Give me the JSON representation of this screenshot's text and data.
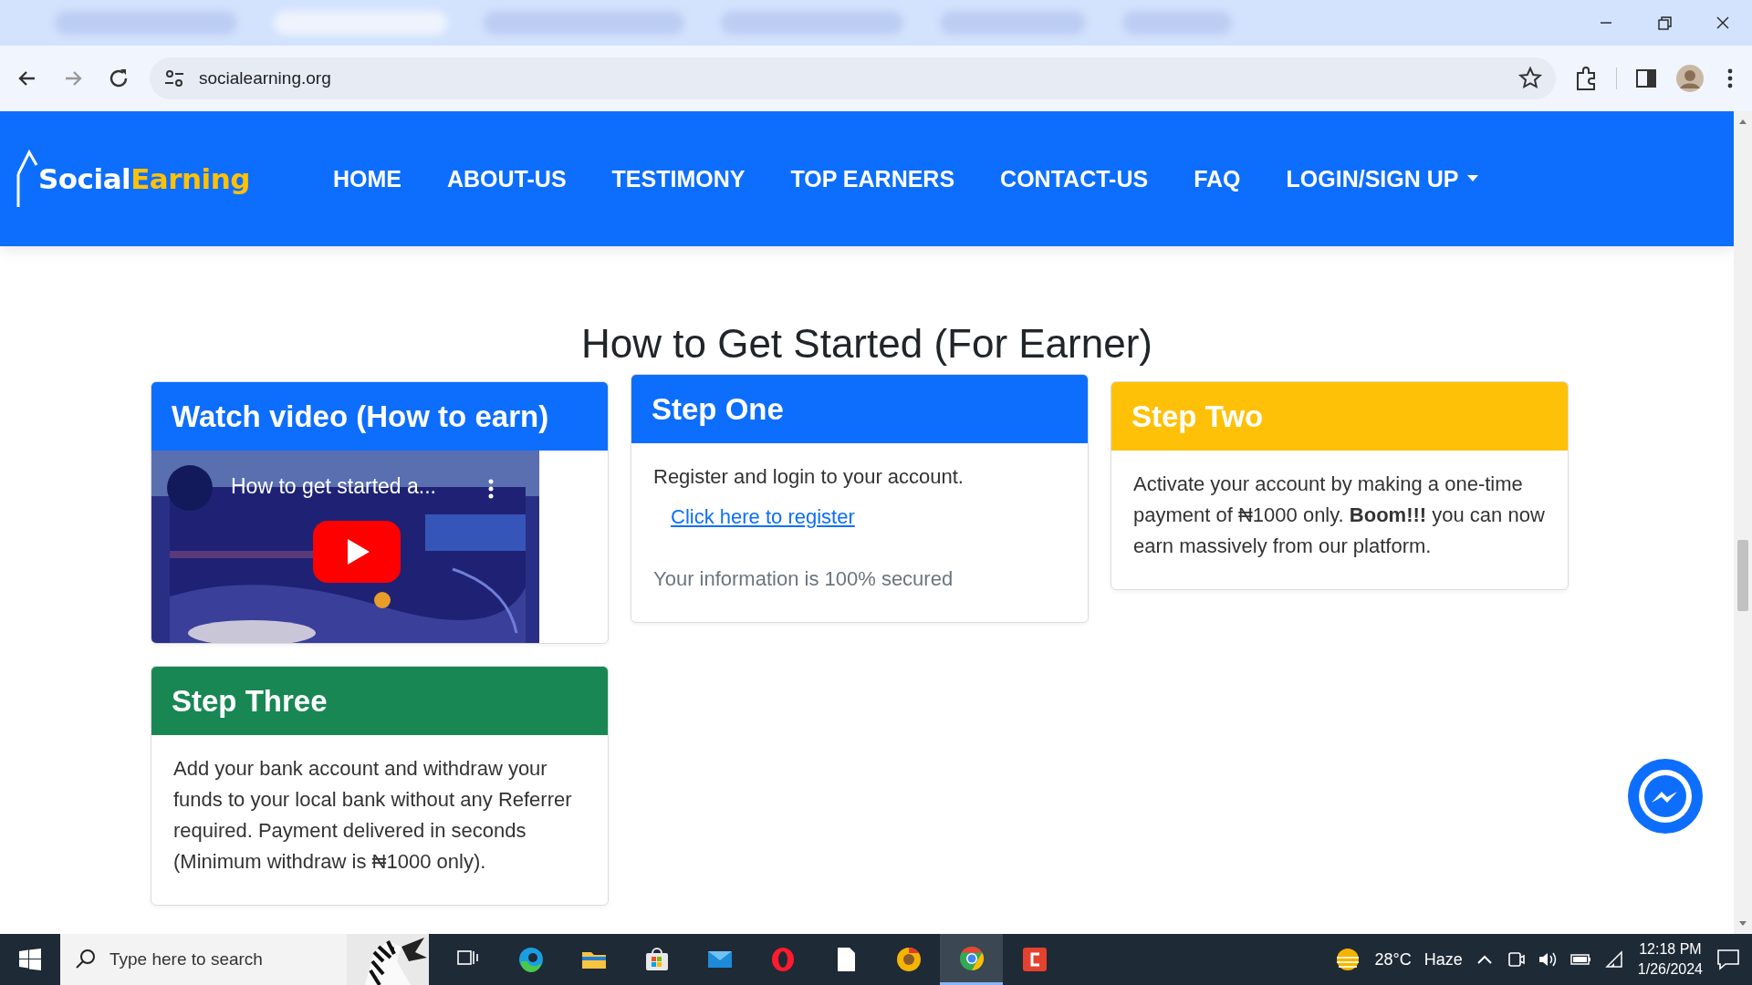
{
  "browser": {
    "tabs": [
      {
        "selected": false
      },
      {
        "selected": true
      },
      {
        "selected": false
      },
      {
        "selected": false
      },
      {
        "selected": false
      },
      {
        "selected": false
      }
    ],
    "url": "socialearning.org"
  },
  "site": {
    "logo": {
      "first": "Social",
      "second": "Earning"
    },
    "nav": [
      {
        "label": "HOME",
        "dropdown": false
      },
      {
        "label": "ABOUT-US",
        "dropdown": false
      },
      {
        "label": "TESTIMONY",
        "dropdown": false
      },
      {
        "label": "TOP EARNERS",
        "dropdown": false
      },
      {
        "label": "CONTACT-US",
        "dropdown": false
      },
      {
        "label": "FAQ",
        "dropdown": false
      },
      {
        "label": "LOGIN/SIGN UP",
        "dropdown": true
      }
    ]
  },
  "heading": "How to Get Started (For Earner)",
  "cards": [
    {
      "kind": "video",
      "title": "Watch video (How to earn)",
      "color": "#0d6efd",
      "video_title": "How to get started a..."
    },
    {
      "kind": "step",
      "title": "Step One",
      "color": "#0d6efd",
      "text": "Register and login to your account.",
      "link": "Click here to register",
      "note": "Your information is 100% secured"
    },
    {
      "kind": "step",
      "title": "Step Two",
      "color": "#ffc107",
      "text": "Activate your account by making a one-time payment of ₦1000 only. **Boom!!!** you can now earn massively from our platform."
    },
    {
      "kind": "step",
      "title": "Step Three",
      "color": "#198754",
      "text": "Add your bank account and withdraw your funds to your local bank without any Referrer required. Payment delivered in seconds (Minimum withdraw is ₦1000 only)."
    }
  ],
  "taskbar": {
    "search_placeholder": "Type here to search",
    "apps": [
      {
        "kind": "taskview",
        "selected": false
      },
      {
        "kind": "edge",
        "selected": false
      },
      {
        "kind": "folder",
        "selected": false
      },
      {
        "kind": "store",
        "selected": false
      },
      {
        "kind": "mail",
        "selected": false
      },
      {
        "kind": "opera",
        "selected": false
      },
      {
        "kind": "file",
        "selected": false
      },
      {
        "kind": "yellowbrowser",
        "selected": false
      },
      {
        "kind": "chrome",
        "selected": true
      },
      {
        "kind": "redapp",
        "selected": false
      }
    ],
    "temperature": "28°C",
    "weather": "Haze",
    "time": "12:18 PM",
    "date": "1/26/2024"
  }
}
